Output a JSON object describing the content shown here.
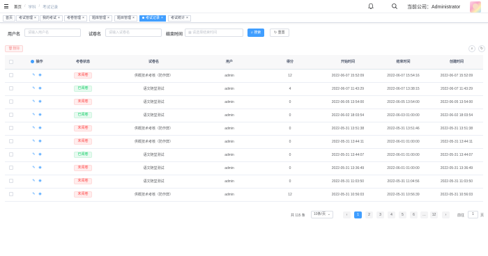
{
  "header": {
    "breadcrumb": [
      "首页",
      "学科",
      "考试记录"
    ],
    "company_label": "当前公司：Administrator"
  },
  "tags": [
    {
      "label": "首页",
      "active": false,
      "closable": false
    },
    {
      "label": "考试管理",
      "active": false,
      "closable": true
    },
    {
      "label": "我的考试",
      "active": false,
      "closable": true
    },
    {
      "label": "考卷管理",
      "active": false,
      "closable": true
    },
    {
      "label": "题库管理",
      "active": false,
      "closable": true
    },
    {
      "label": "题目管理",
      "active": false,
      "closable": true
    },
    {
      "label": "考试记录",
      "active": true,
      "closable": true
    },
    {
      "label": "考试统计",
      "active": false,
      "closable": true
    }
  ],
  "filters": {
    "user_label": "用户名",
    "user_placeholder": "请输入用户名",
    "paper_label": "试卷名",
    "paper_placeholder": "请输入试卷名",
    "end_label": "结束时间",
    "end_placeholder": "请选择结束时间",
    "search_button": "搜索",
    "reset_button": "重置"
  },
  "toolbar": {
    "delete_button": "删除"
  },
  "table": {
    "columns": [
      "操作",
      "考卷状态",
      "试卷名",
      "用户",
      "得分",
      "开始时间",
      "结束时间",
      "创建时间"
    ],
    "rows": [
      {
        "status": "未阅卷",
        "status_color": "red",
        "paper": "供概技术考核（防作弊）",
        "user": "admin",
        "score": "12",
        "start": "2022-06-07 15:52:09",
        "end": "2022-06-07 15:54:16",
        "created": "2022-06-07 15:52:09"
      },
      {
        "status": "已阅卷",
        "status_color": "green",
        "paper": "语文随堂测试",
        "user": "admin",
        "score": "4",
        "start": "2022-06-07 11:43:29",
        "end": "2022-06-07 13:38:15",
        "created": "2022-06-07 11:43:29"
      },
      {
        "status": "未阅卷",
        "status_color": "red",
        "paper": "语文随堂测试",
        "user": "admin",
        "score": "0",
        "start": "2022-06-05 13:54:00",
        "end": "2022-06-05 13:54:00",
        "created": "2022-06-05 13:54:00"
      },
      {
        "status": "已阅卷",
        "status_color": "green",
        "paper": "语文随堂测试",
        "user": "admin",
        "score": "0",
        "start": "2022-06-02 18:03:54",
        "end": "2022-06-03 01:00:00",
        "created": "2022-06-02 18:03:54"
      },
      {
        "status": "未阅卷",
        "status_color": "red",
        "paper": "供概技术考核（防作弊）",
        "user": "admin",
        "score": "0",
        "start": "2022-05-31 13:51:38",
        "end": "2022-05-31 13:51:46",
        "created": "2022-05-31 13:51:38"
      },
      {
        "status": "未阅卷",
        "status_color": "red",
        "paper": "供概技术考核（防作弊）",
        "user": "admin",
        "score": "0",
        "start": "2022-05-31 13:44:11",
        "end": "2022-06-01 01:00:00",
        "created": "2022-05-31 13:44:11"
      },
      {
        "status": "已阅卷",
        "status_color": "green",
        "paper": "语文随堂测试",
        "user": "admin",
        "score": "0",
        "start": "2022-05-31 13:44:07",
        "end": "2022-06-01 01:00:00",
        "created": "2022-05-31 13:44:07"
      },
      {
        "status": "未阅卷",
        "status_color": "red",
        "paper": "语文随堂测试",
        "user": "admin",
        "score": "0",
        "start": "2022-05-31 13:36:49",
        "end": "2022-06-01 01:00:00",
        "created": "2022-05-31 13:36:49"
      },
      {
        "status": "未阅卷",
        "status_color": "red",
        "paper": "语文随堂测试",
        "user": "admin",
        "score": "0",
        "start": "2022-05-31 11:03:50",
        "end": "2022-05-31 11:04:56",
        "created": "2022-05-31 11:03:50"
      },
      {
        "status": "未阅卷",
        "status_color": "red",
        "paper": "供概技术考核（防作弊）",
        "user": "admin",
        "score": "12",
        "start": "2022-05-31 10:56:03",
        "end": "2022-05-31 10:56:39",
        "created": "2022-05-31 10:56:03"
      }
    ]
  },
  "pagination": {
    "total": "共 115 条",
    "page_size": "10条/页",
    "pages": [
      "1",
      "2",
      "3",
      "4",
      "5",
      "6",
      "…",
      "12"
    ],
    "current": "1",
    "jump_label": "前往",
    "jump_value": "1",
    "jump_suffix": "页"
  },
  "colors": {
    "primary": "#409eff",
    "danger": "#ff4949",
    "success": "#13ce66"
  }
}
